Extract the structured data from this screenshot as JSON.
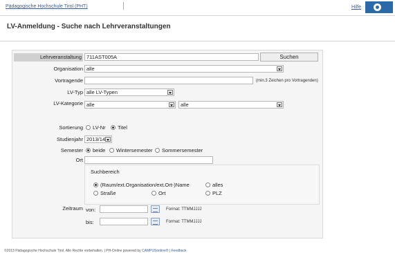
{
  "header": {
    "breadcrumb": "Pädagogische Hochschule Tirol (PHT)",
    "help": "Hilfe"
  },
  "page": {
    "title": "LV-Anmeldung - Suche nach Lehrveranstaltungen"
  },
  "form": {
    "lehrveranstaltung": {
      "label": "Lehrveranstaltung",
      "value": "711AST005A"
    },
    "search_button": "Suchen",
    "organisation": {
      "label": "Organisation",
      "value": "alle"
    },
    "vortragende": {
      "label": "Vortragende",
      "value": "",
      "hint": "(min.3 Zeichen pro Vortragenden)"
    },
    "lv_typ": {
      "label": "LV-Typ",
      "value": "alle LV-Typen"
    },
    "lv_kategorie": {
      "label": "LV-Kategorie",
      "value1": "alle",
      "value2": "alle"
    },
    "sortierung": {
      "label": "Sortierung",
      "options": [
        "LV-Nr",
        "Titel"
      ],
      "selected": "Titel"
    },
    "studienjahr": {
      "label": "Studienjahr",
      "value": "2013/14"
    },
    "semester": {
      "label": "Semester",
      "options": [
        "beide",
        "Wintersemester",
        "Sommersemester"
      ],
      "selected": "beide"
    },
    "ort": {
      "label": "Ort",
      "value": ""
    },
    "suchbereich": {
      "title": "Suchbereich",
      "options": [
        "(Raum/ext.Organisation/ext.Ort-)Name",
        "alles",
        "Straße",
        "Ort",
        "PLZ"
      ],
      "selected": "(Raum/ext.Organisation/ext.Ort-)Name"
    },
    "zeitraum": {
      "label": "Zeitraum",
      "von_label": "von:",
      "bis_label": "bis:",
      "von_format": "Format: TTMMJJJJ",
      "bis_format": "Format: TTMMJJJJ"
    }
  },
  "footer": {
    "text": "©2013 Pädagogische Hochschule Tirol. Alle Rechte vorbehalten. | PH-Online powered by ",
    "campus": "CAMPUSonline®",
    "feedback": "| Feedback"
  }
}
